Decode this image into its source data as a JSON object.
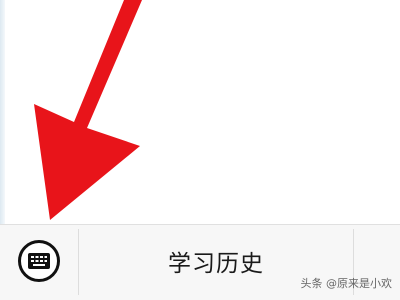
{
  "menu": {
    "keyboard_icon": "keyboard-icon",
    "item_label": "学习历史"
  },
  "annotation": {
    "arrow_color": "#e8141a"
  },
  "watermark": {
    "text": "头条 @原来是小欢"
  }
}
